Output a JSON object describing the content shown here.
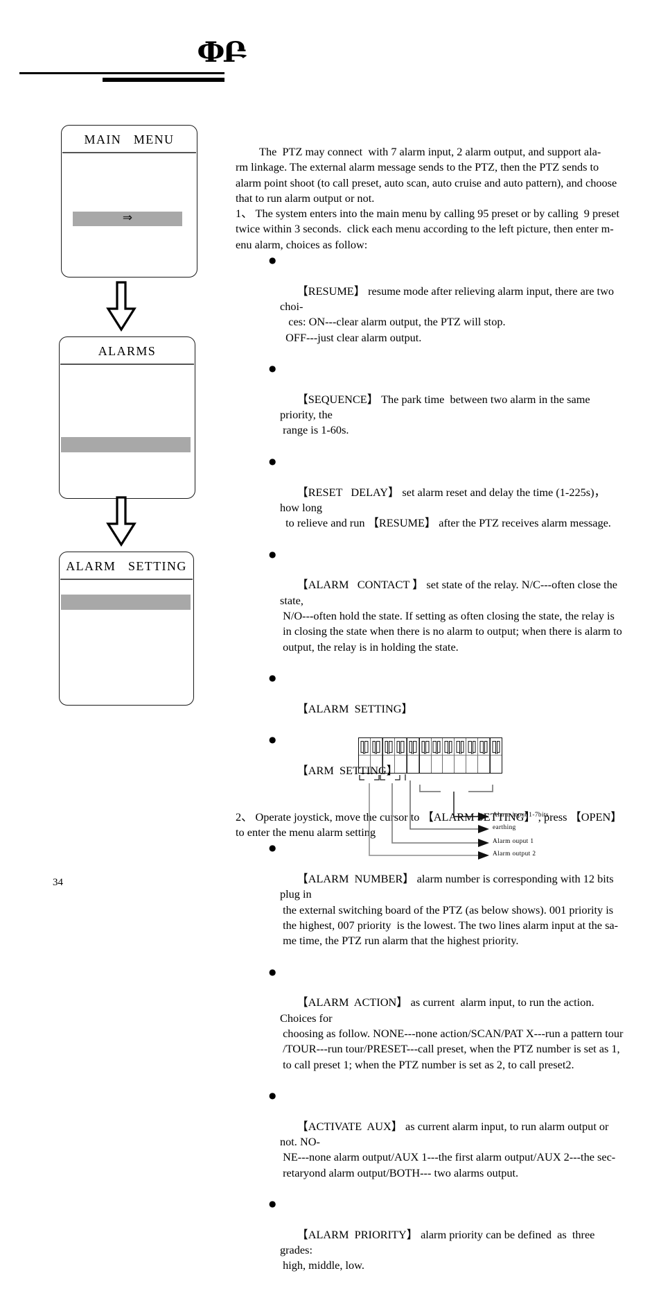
{
  "header": {
    "ornament": "ՓԲ",
    "ornament_name": "decorative-flourish"
  },
  "menus": [
    {
      "id": "main-menu",
      "title": "MAIN   MENU",
      "highlight_arrow": "⇒"
    },
    {
      "id": "alarms",
      "title": "ALARMS",
      "highlight_arrow": ""
    },
    {
      "id": "alarm-setting",
      "title": "ALARM   SETTING",
      "highlight_arrow": ""
    }
  ],
  "body": {
    "intro": "The  PTZ may connect  with 7 alarm input, 2 alarm output, and support ala-\nrm linkage. The external alarm message sends to the PTZ, then the PTZ sends to\nalarm point shoot (to call preset, auto scan, auto cruise and auto pattern), and choose\nthat to run alarm output or not.",
    "step1": "1、 The system enters into the main menu by calling 95 preset or by calling  9 preset\ntwice within 3 seconds.  click each menu according to the left picture, then enter m-\nenu alarm, choices as follow:",
    "bullets_group1": [
      {
        "dot": "●",
        "text": "【RESUME】 resume mode after relieving alarm input, there are two choi-\n   ces: ON---clear alarm output, the PTZ will stop.\n  OFF---just clear alarm output."
      },
      {
        "dot": "●",
        "text": "【SEQUENCE】 The park time  between two alarm in the same priority, the\n range is 1-60s."
      },
      {
        "dot": "●",
        "text": "【RESET   DELAY】 set alarm reset and delay the time (1-225s)， how long\n  to relieve and run 【RESUME】 after the PTZ receives alarm message."
      },
      {
        "dot": "●",
        "text": "【ALARM   CONTACT 】 set state of the relay. N/C---often close the state,\n N/O---often hold the state. If setting as often closing the state, the relay is\n in closing the state when there is no alarm to output; when there is alarm to\n output, the relay is in holding the state."
      },
      {
        "dot": "●",
        "text": "【ALARM  SETTING】"
      },
      {
        "dot": "●",
        "text": "【ARM  SETTING】"
      }
    ],
    "step2": "2、 Operate joystick, move the cursor to 【ALARM SETTING】 , press 【OPEN】\nto enter the menu alarm setting",
    "bullets_group2": [
      {
        "dot": "●",
        "text": "【ALARM  NUMBER】 alarm number is corresponding with 12 bits plug in\n the external switching board of the PTZ (as below shows). 001 priority is\n the highest, 007 priority  is the lowest. The two lines alarm input at the sa-\n me time, the PTZ run alarm that the highest priority."
      },
      {
        "dot": "●",
        "text": "【ALARM  ACTION】 as current  alarm input, to run the action. Choices for\n choosing as follow. NONE---none action/SCAN/PAT X---run a pattern tour\n /TOUR---run tour/PRESET---call preset, when the PTZ number is set as 1,\n to call preset 1; when the PTZ number is set as 2, to call preset2."
      },
      {
        "dot": "●",
        "text": "【ACTIVATE  AUX】 as current alarm input, to run alarm output or not. NO-\n NE---none alarm output/AUX 1---the first alarm output/AUX 2---the sec-\n retaryond alarm output/BOTH--- two alarms output."
      },
      {
        "dot": "●",
        "text": "【ALARM  PRIORITY】 alarm priority can be defined  as  three grades:\n high, middle, low."
      }
    ]
  },
  "terminal_diagram": {
    "terminal_count": 12,
    "labels": [
      "Alarm input 1-7bits",
      "earthing",
      "Alarm ouput 1",
      "Alarm output 2"
    ]
  },
  "footer": {
    "page_number": "34"
  },
  "colors": {
    "highlight_gray": "#a8a8a8",
    "rule_black": "#000000",
    "leader_gray": "#777777"
  }
}
